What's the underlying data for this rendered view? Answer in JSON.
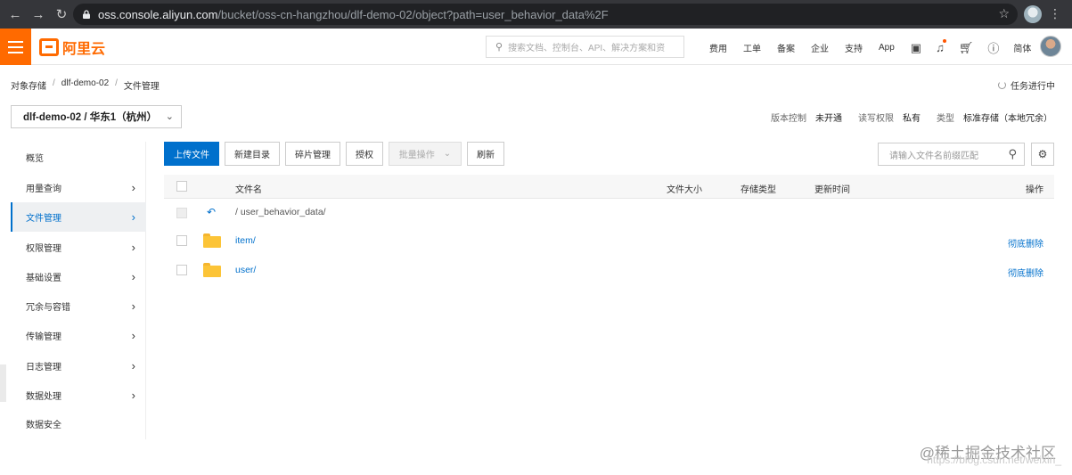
{
  "browser": {
    "url_host": "oss.console.aliyun.com",
    "url_path": "/bucket/oss-cn-hangzhou/dlf-demo-02/object?path=user_behavior_data%2F"
  },
  "topnav": {
    "brand": "阿里云",
    "search_placeholder": "搜索文档、控制台、API、解决方案和资",
    "menu": [
      "费用",
      "工单",
      "备案",
      "企业",
      "支持",
      "App"
    ],
    "lang": "简体"
  },
  "breadcrumb": [
    "对象存储",
    "dlf-demo-02",
    "文件管理"
  ],
  "task_label": "任务进行中",
  "bucket_selector": "dlf-demo-02 / 华东1（杭州）",
  "meta": [
    {
      "key": "版本控制",
      "value": "未开通"
    },
    {
      "key": "读写权限",
      "value": "私有"
    },
    {
      "key": "类型",
      "value": "标准存储（本地冗余）"
    }
  ],
  "sidebar": {
    "items": [
      {
        "label": "概览",
        "arrow": false,
        "active": false
      },
      {
        "label": "用量查询",
        "arrow": true,
        "active": false
      },
      {
        "label": "文件管理",
        "arrow": true,
        "active": true
      },
      {
        "label": "权限管理",
        "arrow": true,
        "active": false
      },
      {
        "label": "基础设置",
        "arrow": true,
        "active": false
      },
      {
        "label": "冗余与容错",
        "arrow": true,
        "active": false
      },
      {
        "label": "传输管理",
        "arrow": true,
        "active": false
      },
      {
        "label": "日志管理",
        "arrow": true,
        "active": false
      },
      {
        "label": "数据处理",
        "arrow": true,
        "active": false
      },
      {
        "label": "数据安全",
        "arrow": false,
        "active": false
      }
    ]
  },
  "toolbar": {
    "upload": "上传文件",
    "new_dir": "新建目录",
    "fragments": "碎片管理",
    "authorize": "授权",
    "batch": "批量操作",
    "refresh": "刷新",
    "search_placeholder": "请输入文件名前缀匹配"
  },
  "table": {
    "headers": {
      "name": "文件名",
      "size": "文件大小",
      "storage": "存储类型",
      "updated": "更新时间",
      "actions": "操作"
    },
    "parent_path": "/ user_behavior_data/",
    "rows": [
      {
        "name": "item/",
        "action": "彻底删除"
      },
      {
        "name": "user/",
        "action": "彻底删除"
      }
    ]
  },
  "watermark": {
    "line1": "@稀土掘金技术社区",
    "line2": "https://blog.csdn.net/weixin_"
  }
}
